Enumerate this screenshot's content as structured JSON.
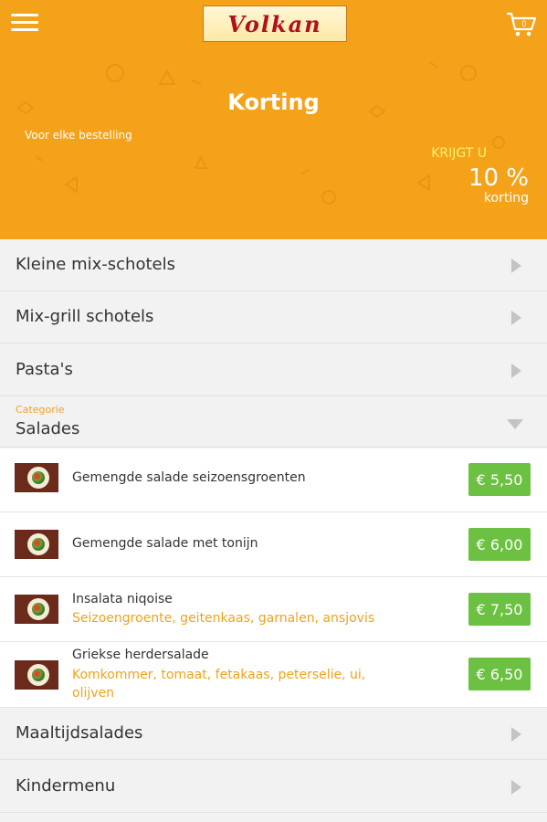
{
  "header": {
    "logo_text": "Volkan",
    "menu_icon": "hamburger-menu-icon",
    "cart_icon": "shopping-cart-icon",
    "cart_count": "0"
  },
  "promo": {
    "title": "Korting",
    "subtitle": "Voor elke bestelling",
    "label": "KRIJGT U",
    "value": "10 %",
    "unit": "korting"
  },
  "categories_top": [
    {
      "label": "Kleine mix-schotels"
    },
    {
      "label": "Mix-grill schotels"
    },
    {
      "label": "Pasta's"
    }
  ],
  "open_category": {
    "caption": "Categorie",
    "label": "Salades",
    "items": [
      {
        "name": "Gemengde salade seizoensgroenten",
        "desc": "",
        "price": "€ 5,50"
      },
      {
        "name": "Gemengde salade met tonijn",
        "desc": "",
        "price": "€ 6,00"
      },
      {
        "name": "Insalata niqoise",
        "desc": "Seizoengroente, geitenkaas, garnalen, ansjovis",
        "price": "€ 7,50"
      },
      {
        "name": "Griekse herdersalade",
        "desc": "Komkommer, tomaat, fetakaas, peterselie, ui, olijven",
        "price": "€ 6,50"
      }
    ]
  },
  "categories_bottom": [
    {
      "label": "Maaltijdsalades"
    },
    {
      "label": "Kindermenu"
    }
  ],
  "colors": {
    "accent": "#f5a21b",
    "price_green": "#6cc142",
    "desc_orange": "#f0a318"
  }
}
